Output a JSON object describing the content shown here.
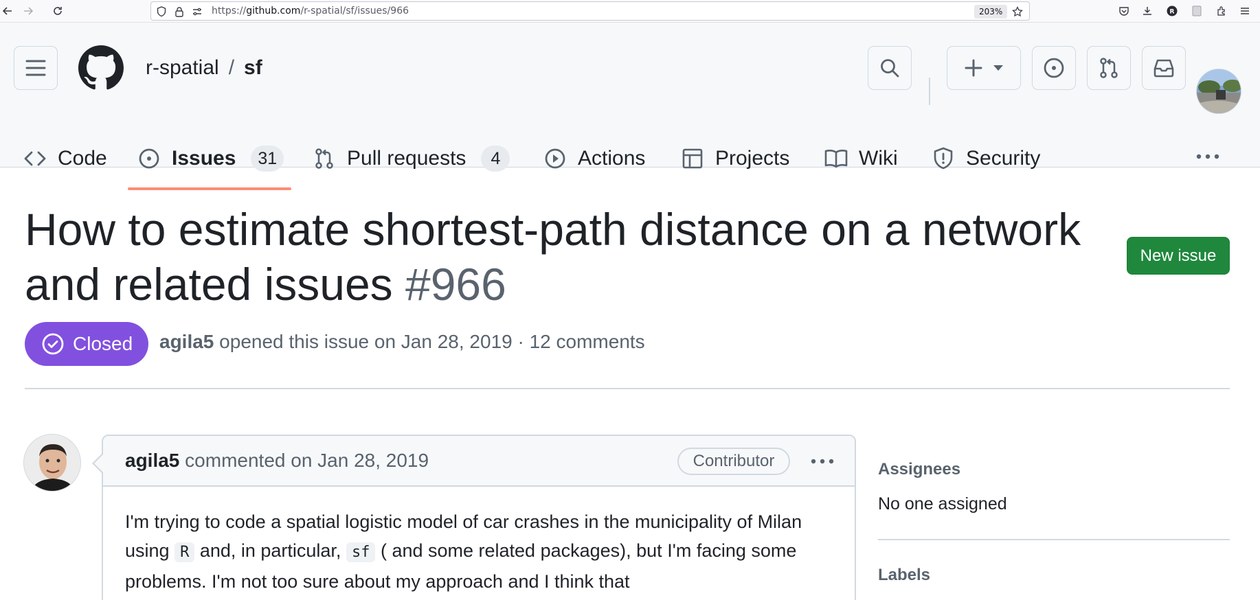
{
  "browser": {
    "url_prefix": "https://",
    "url_domain": "github.com",
    "url_path": "/r-spatial/sf/issues/966",
    "zoom": "203%"
  },
  "header": {
    "owner": "r-spatial",
    "separator": "/",
    "repo": "sf"
  },
  "tabs": [
    {
      "label": "Code"
    },
    {
      "label": "Issues",
      "count": "31"
    },
    {
      "label": "Pull requests",
      "count": "4"
    },
    {
      "label": "Actions"
    },
    {
      "label": "Projects"
    },
    {
      "label": "Wiki"
    },
    {
      "label": "Security"
    }
  ],
  "issue": {
    "title": "How to estimate shortest-path distance on a network and related issues",
    "number": "#966",
    "new_issue_label": "New issue",
    "state": "Closed",
    "author": "agila5",
    "opened_text": "opened this issue on Jan 28, 2019 · 12 comments"
  },
  "comment": {
    "author": "agila5",
    "meta": "commented on Jan 28, 2019",
    "role": "Contributor",
    "body_part1": "I'm trying to code a spatial logistic model of car crashes in the municipality of Milan using ",
    "code1": "R",
    "body_part2": " and, in particular, ",
    "code2": "sf",
    "body_part3": " ( and some related packages), but I'm facing some problems. I'm not too sure about my approach and I think that"
  },
  "sidebar": {
    "assignees_heading": "Assignees",
    "assignees_value": "No one assigned",
    "labels_heading": "Labels"
  },
  "colors": {
    "closed_badge": "#8250df",
    "new_issue_button": "#1f883d",
    "tab_underline": "#fd8c73"
  }
}
